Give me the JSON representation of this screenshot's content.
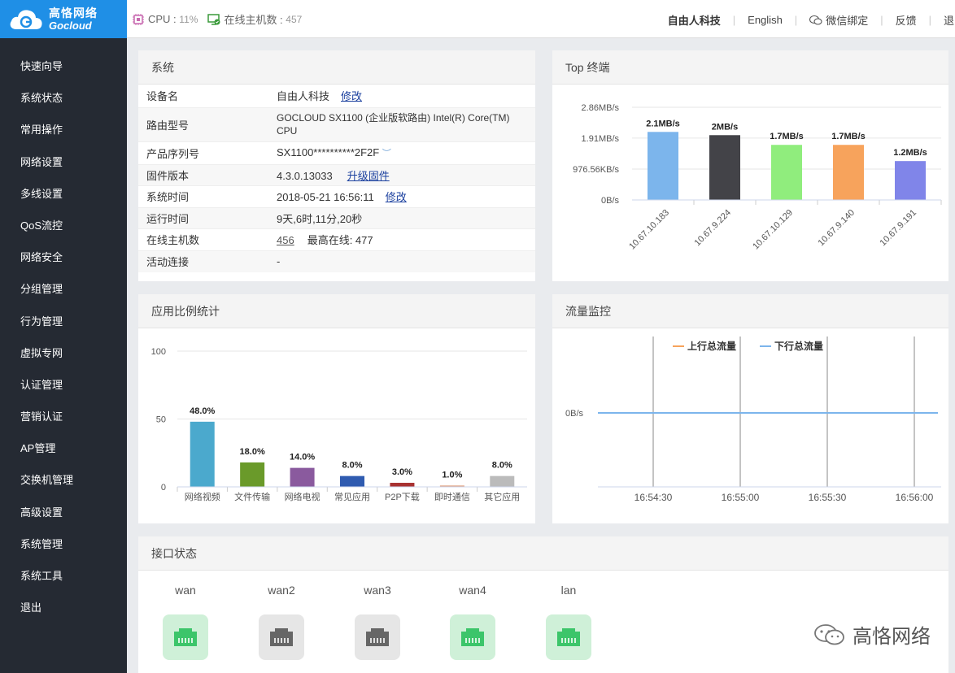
{
  "brand": {
    "name_cn": "高恪网络",
    "name_en": "Gocloud"
  },
  "topbar": {
    "cpu_label": "CPU :",
    "cpu_value": "11%",
    "online_label": "在线主机数 :",
    "online_value": "457",
    "links": [
      "自由人科技",
      "English",
      "微信绑定",
      "反馈",
      "退出"
    ]
  },
  "sidebar": {
    "items": [
      "快速向导",
      "系统状态",
      "常用操作",
      "网络设置",
      "多线设置",
      "QoS流控",
      "网络安全",
      "分组管理",
      "行为管理",
      "虚拟专网",
      "认证管理",
      "营销认证",
      "AP管理",
      "交换机管理",
      "高级设置",
      "系统管理",
      "系统工具",
      "退出"
    ]
  },
  "system": {
    "title": "系统",
    "rows": [
      {
        "k": "设备名",
        "v": "自由人科技",
        "link": "修改"
      },
      {
        "k": "路由型号",
        "v": "GOCLOUD SX1100 (企业版软路由) Intel(R) Core(TM) CPU"
      },
      {
        "k": "产品序列号",
        "v": "SX1100**********2F2F"
      },
      {
        "k": "固件版本",
        "v": "4.3.0.13033",
        "link": "升级固件"
      },
      {
        "k": "系统时间",
        "v": "2018-05-21 16:56:11",
        "link": "修改"
      },
      {
        "k": "运行时间",
        "v": "9天,6时,11分,20秒"
      },
      {
        "k": "在线主机数",
        "v": "456",
        "extra": "最高在线: 477"
      },
      {
        "k": "活动连接",
        "v": "-"
      }
    ]
  },
  "top_terminals": {
    "title": "Top 终端",
    "chart_data": {
      "type": "bar",
      "categories": [
        "10.67.10.183",
        "10.67.9.224",
        "10.67.10.129",
        "10.67.9.140",
        "10.67.9.191"
      ],
      "values": [
        2.1,
        2.0,
        1.7,
        1.7,
        1.2
      ],
      "value_labels": [
        "2.1MB/s",
        "2MB/s",
        "1.7MB/s",
        "1.7MB/s",
        "1.2MB/s"
      ],
      "y_ticks": [
        "0B/s",
        "976.56KB/s",
        "1.91MB/s",
        "2.86MB/s"
      ],
      "y_tick_values": [
        0,
        0.954,
        1.91,
        2.86
      ],
      "ylim": [
        0,
        2.86
      ],
      "colors": [
        "#7cb5ec",
        "#434348",
        "#90ed7d",
        "#f7a35c",
        "#8085e9"
      ]
    }
  },
  "app_stats": {
    "title": "应用比例统计",
    "chart_data": {
      "type": "bar",
      "categories": [
        "网络视频",
        "文件传输",
        "网络电视",
        "常见应用",
        "P2P下载",
        "即时通信",
        "其它应用"
      ],
      "values": [
        48.0,
        18.0,
        14.0,
        8.0,
        3.0,
        1.0,
        8.0
      ],
      "value_labels": [
        "48.0%",
        "18.0%",
        "14.0%",
        "8.0%",
        "3.0%",
        "1.0%",
        "8.0%"
      ],
      "y_ticks": [
        "0",
        "50",
        "100"
      ],
      "y_tick_values": [
        0,
        50,
        100
      ],
      "ylim": [
        0,
        100
      ],
      "colors": [
        "#4ba9cd",
        "#6a9a2a",
        "#8a5a9e",
        "#2f5bb0",
        "#a83232",
        "#e0a080",
        "#bbbbbb"
      ]
    }
  },
  "traffic": {
    "title": "流量监控",
    "chart_data": {
      "type": "line",
      "series": [
        {
          "name": "上行总流量",
          "color": "#f7a35c",
          "values": [
            0,
            0
          ]
        },
        {
          "name": "下行总流量",
          "color": "#7cb5ec",
          "values": [
            0,
            0
          ]
        }
      ],
      "y_tick": "0B/s",
      "x_ticks": [
        "16:54:30",
        "16:55:00",
        "16:55:30",
        "16:56:00"
      ]
    }
  },
  "interfaces": {
    "title": "接口状态",
    "items": [
      {
        "name": "wan",
        "status": "on"
      },
      {
        "name": "wan2",
        "status": "off"
      },
      {
        "name": "wan3",
        "status": "off"
      },
      {
        "name": "wan4",
        "status": "on"
      },
      {
        "name": "lan",
        "status": "on"
      }
    ]
  },
  "watermark": "高恪网络"
}
